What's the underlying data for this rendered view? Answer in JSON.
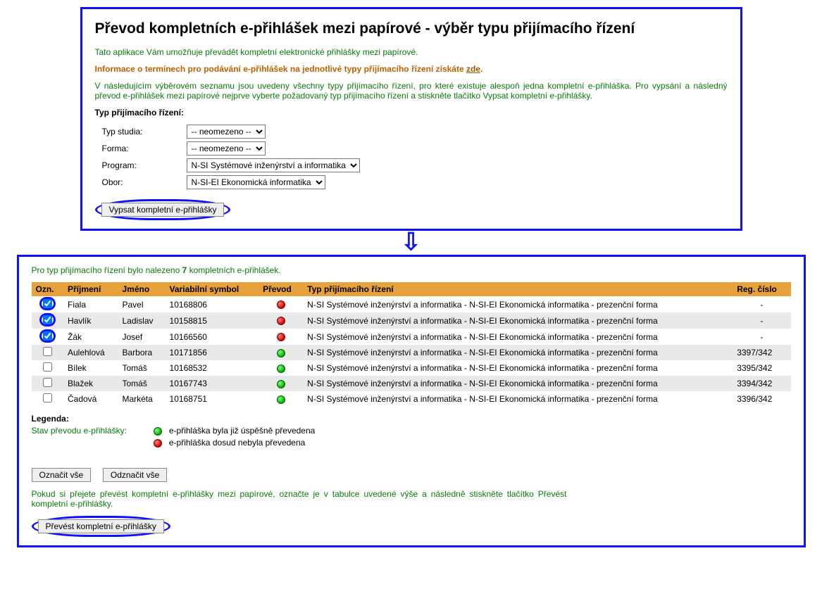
{
  "header": {
    "title": "Převod kompletních e-přihlášek mezi papírové - výběr typu přijímacího řízení"
  },
  "intro1": "Tato aplikace Vám umožňuje převádět kompletní elektronické přihlášky mezi papírové.",
  "intro2_prefix": "Informace o termínech pro podávání e-přihlášek na jednotlivé typy přijímacího řízení získáte ",
  "intro2_link": "zde",
  "intro2_suffix": ".",
  "intro3": "V následujícím výběrovém seznamu jsou uvedeny všechny typy přijímacího řízení, pro které existuje alespoň jedna kompletní e-přihláška. Pro vypsání a následný převod e-přihlášek mezi papírové nejprve vyberte požadovaný typ přijímacího řízení a stiskněte tlačítko Vypsat kompletní e-přihlášky.",
  "form": {
    "heading": "Typ přijímacího řízení:",
    "rows": {
      "typ_label": "Typ studia:",
      "forma_label": "Forma:",
      "program_label": "Program:",
      "obor_label": "Obor:"
    },
    "values": {
      "typ": "-- neomezeno --",
      "forma": "-- neomezeno --",
      "program": "N-SI Systémové inženýrství a informatika",
      "obor": "N-SI-EI Ekonomická informatika"
    },
    "submit": "Vypsat kompletní e-přihlášky"
  },
  "result_sentence_prefix": "Pro typ přijímacího řízení bylo nalezeno ",
  "result_count": "7",
  "result_sentence_suffix": " kompletních e-přihlášek.",
  "table": {
    "headers": {
      "ozn": "Ozn.",
      "prijmeni": "Příjmení",
      "jmeno": "Jméno",
      "vs": "Variabilní symbol",
      "prevod": "Převod",
      "typ": "Typ přijímacího řízení",
      "reg": "Reg. číslo"
    },
    "typ_text": "N-SI Systémové inženýrství a informatika - N-SI-EI Ekonomická informatika - prezenční forma",
    "rows": [
      {
        "checked": true,
        "circled": true,
        "prijmeni": "Fiala",
        "jmeno": "Pavel",
        "vs": "10168806",
        "status": "red",
        "reg": "-",
        "alt": false,
        "reg_center": true
      },
      {
        "checked": true,
        "circled": true,
        "prijmeni": "Havlík",
        "jmeno": "Ladislav",
        "vs": "10158815",
        "status": "red",
        "reg": "-",
        "alt": true,
        "reg_center": true
      },
      {
        "checked": true,
        "circled": true,
        "prijmeni": "Žák",
        "jmeno": "Josef",
        "vs": "10166560",
        "status": "red",
        "reg": "-",
        "alt": false,
        "reg_center": true
      },
      {
        "checked": false,
        "circled": false,
        "prijmeni": "Aulehlová",
        "jmeno": "Barbora",
        "vs": "10171856",
        "status": "green",
        "reg": "3397/342",
        "alt": true,
        "reg_center": false
      },
      {
        "checked": false,
        "circled": false,
        "prijmeni": "Bílek",
        "jmeno": "Tomáš",
        "vs": "10168532",
        "status": "green",
        "reg": "3395/342",
        "alt": false,
        "reg_center": false
      },
      {
        "checked": false,
        "circled": false,
        "prijmeni": "Blažek",
        "jmeno": "Tomáš",
        "vs": "10167743",
        "status": "green",
        "reg": "3394/342",
        "alt": true,
        "reg_center": false
      },
      {
        "checked": false,
        "circled": false,
        "prijmeni": "Čadová",
        "jmeno": "Markéta",
        "vs": "10168751",
        "status": "green",
        "reg": "3396/342",
        "alt": false,
        "reg_center": false
      }
    ]
  },
  "legend": {
    "title": "Legenda:",
    "label": "Stav převodu e-přihlášky:",
    "green_text": "e-přihláška byla již úspěšně převedena",
    "red_text": "e-přihláška dosud nebyla převedena"
  },
  "buttons": {
    "select_all": "Označit vše",
    "deselect_all": "Odznačit vše",
    "convert": "Převést kompletní e-přihlášky"
  },
  "footer_text": "Pokud si přejete převést kompletní e-přihlášky mezi papírové, označte je v tabulce uvedené výše a následně stiskněte tlačítko Převést kompletní e-přihlášky."
}
